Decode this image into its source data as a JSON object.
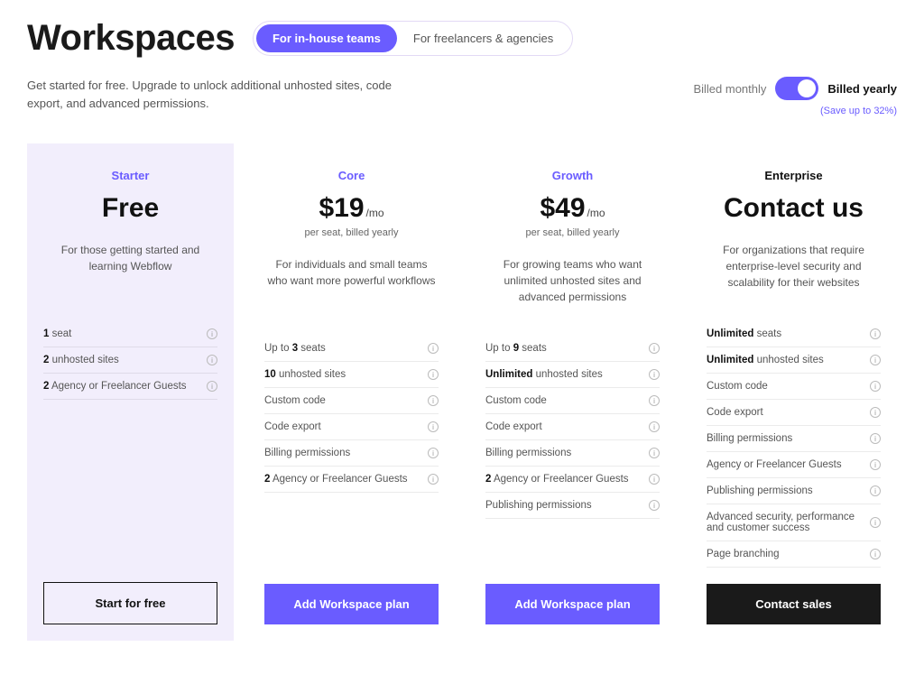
{
  "header": {
    "title": "Workspaces",
    "audience": {
      "options": [
        "For in-house teams",
        "For freelancers & agencies"
      ],
      "active": 0
    },
    "subheading": "Get started for free. Upgrade to unlock additional unhosted sites, code export, and advanced permissions.",
    "billing": {
      "monthly_label": "Billed monthly",
      "yearly_label": "Billed yearly",
      "active": "yearly",
      "save_note": "(Save up to 32%)"
    }
  },
  "plans": [
    {
      "id": "starter",
      "tinted": true,
      "name": "Starter",
      "price": "Free",
      "price_suffix": "",
      "price_sub": "",
      "description": "For those getting started and learning Webflow",
      "features": [
        {
          "bold": "1",
          "rest": " seat"
        },
        {
          "bold": "2",
          "rest": " unhosted sites"
        },
        {
          "bold": "2",
          "rest": " Agency or Freelancer Guests"
        }
      ],
      "cta": {
        "label": "Start for free",
        "style": "outline"
      }
    },
    {
      "id": "core",
      "tinted": false,
      "name": "Core",
      "price": "$19",
      "price_suffix": "/mo",
      "price_sub": "per seat, billed yearly",
      "description": "For individuals and small teams who want more powerful workflows",
      "features": [
        {
          "bold": "",
          "rest": "Up to ",
          "bold2": "3",
          "rest2": " seats"
        },
        {
          "bold": "10",
          "rest": " unhosted sites"
        },
        {
          "bold": "",
          "rest": "Custom code"
        },
        {
          "bold": "",
          "rest": "Code export"
        },
        {
          "bold": "",
          "rest": "Billing permissions"
        },
        {
          "bold": "2",
          "rest": " Agency or Freelancer Guests"
        }
      ],
      "cta": {
        "label": "Add Workspace plan",
        "style": "primary"
      }
    },
    {
      "id": "growth",
      "tinted": false,
      "name": "Growth",
      "price": "$49",
      "price_suffix": "/mo",
      "price_sub": "per seat, billed yearly",
      "description": "For growing teams who want unlimited unhosted sites and advanced permissions",
      "features": [
        {
          "bold": "",
          "rest": "Up to ",
          "bold2": "9",
          "rest2": " seats"
        },
        {
          "bold": "Unlimited",
          "rest": " unhosted sites"
        },
        {
          "bold": "",
          "rest": "Custom code"
        },
        {
          "bold": "",
          "rest": "Code export"
        },
        {
          "bold": "",
          "rest": "Billing permissions"
        },
        {
          "bold": "2",
          "rest": " Agency or Freelancer Guests"
        },
        {
          "bold": "",
          "rest": "Publishing permissions"
        }
      ],
      "cta": {
        "label": "Add Workspace plan",
        "style": "primary"
      }
    },
    {
      "id": "enterprise",
      "tinted": false,
      "name": "Enterprise",
      "price": "Contact us",
      "price_suffix": "",
      "price_sub": "",
      "description": "For organizations that require enterprise-level security and scalability for their websites",
      "features": [
        {
          "bold": "Unlimited",
          "rest": " seats"
        },
        {
          "bold": "Unlimited",
          "rest": " unhosted sites"
        },
        {
          "bold": "",
          "rest": "Custom code"
        },
        {
          "bold": "",
          "rest": "Code export"
        },
        {
          "bold": "",
          "rest": "Billing permissions"
        },
        {
          "bold": "",
          "rest": "Agency or Freelancer Guests"
        },
        {
          "bold": "",
          "rest": "Publishing permissions"
        },
        {
          "bold": "",
          "rest": "Advanced security, performance and customer success"
        },
        {
          "bold": "",
          "rest": "Page branching"
        }
      ],
      "cta": {
        "label": "Contact sales",
        "style": "dark"
      }
    }
  ]
}
